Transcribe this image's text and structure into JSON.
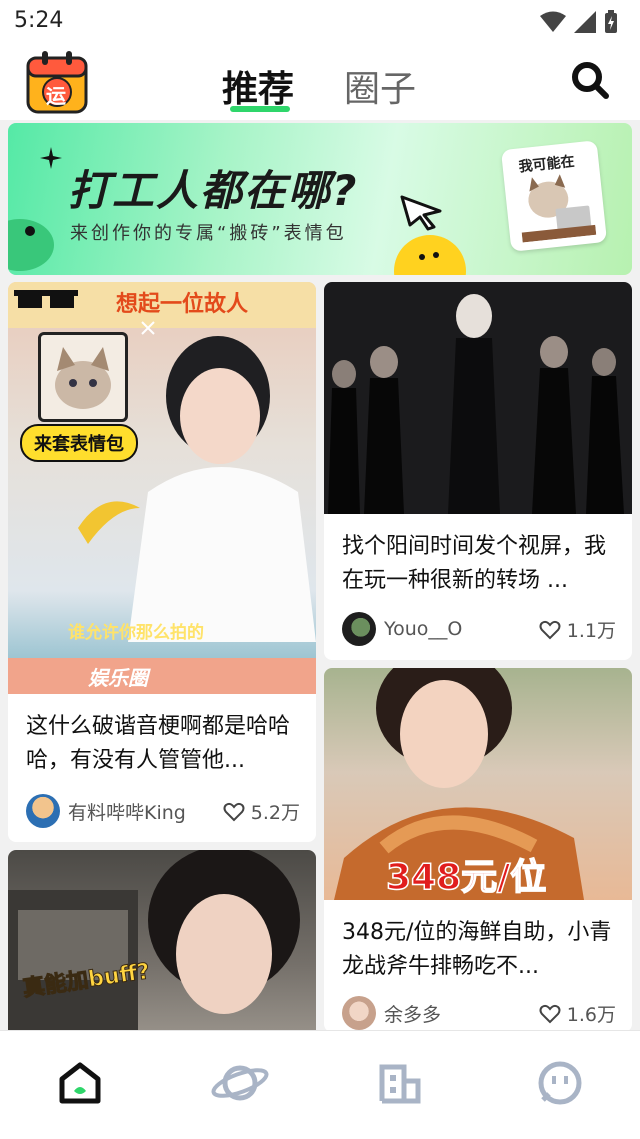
{
  "status": {
    "time": "5:24"
  },
  "header": {
    "tabs": [
      {
        "label": "推荐"
      },
      {
        "label": "圈子"
      }
    ],
    "logo_char": "运"
  },
  "banner": {
    "title": "打工人都在哪?",
    "subtitle": "来创作你的专属“搬砖”表情包",
    "sticker_text": "我可能在"
  },
  "posts": [
    {
      "overlay_top": "想起一位故人",
      "overlay_badge": "来套表情包",
      "overlay_bottom": "谁允许你那么拍的",
      "overlay_footer": "娱乐圈",
      "title": "这什么破谐音梗啊都是哈哈哈，有没有人管管他...",
      "author": "有料哔哔King",
      "likes": "5.2万"
    },
    {
      "title": "找个阳间时间发个视屏，我在玩一种很新的转场 ...",
      "author": "Youo__O",
      "likes": "1.1万"
    },
    {
      "overlay_text": "348元/位",
      "title": "348元/位的海鲜自助，小青龙战斧牛排畅吃不...",
      "author": "余多多",
      "likes": "1.6万"
    },
    {
      "overlay_text": "真能加buff?"
    }
  ],
  "colors": {
    "accent": "#2fd66b",
    "nav_inactive": "#a9b4c6"
  },
  "nav": [
    "home-icon",
    "planet-icon",
    "building-icon",
    "chat-face-icon"
  ]
}
